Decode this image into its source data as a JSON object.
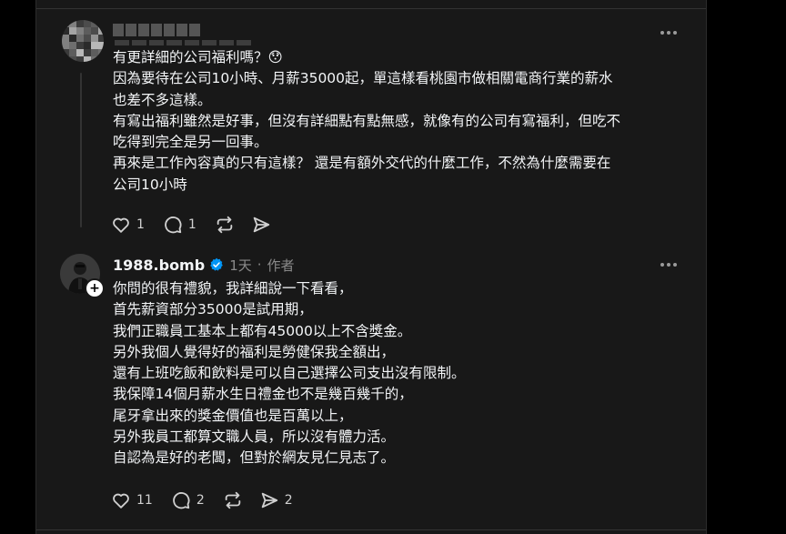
{
  "colors": {
    "background": "#000000",
    "panel": "#181818",
    "text": "#f3f5f7",
    "muted": "#8a8a8a",
    "verified": "#0095f6"
  },
  "comment1": {
    "username": "",
    "lines": [
      "有更詳細的公司福利嗎？😯",
      "因為要待在公司10小時、月薪35000起，單這樣看桃園市做相關電商行業的薪水",
      "也差不多這樣。",
      "有寫出福利雖然是好事，但沒有詳細點有點無感，就像有的公司有寫福利，但吃不",
      "吃得到完全是另一回事。",
      "再來是工作內容真的只有這樣？ 還是有額外交代的什麼工作，不然為什麼需要在",
      "公司10小時"
    ],
    "like_count": "1",
    "reply_count": "1",
    "icons": [
      "heart-icon",
      "comment-icon",
      "repost-icon",
      "share-icon",
      "more-icon"
    ]
  },
  "comment2": {
    "username": "1988.bomb",
    "time": "1天",
    "separator": "·",
    "author_label": "作者",
    "lines": [
      "你問的很有禮貌，我詳細說一下看看，",
      "首先薪資部分35000是試用期，",
      "我們正職員工基本上都有45000以上不含獎金。",
      "另外我個人覺得好的福利是勞健保我全額出，",
      "還有上班吃飯和飲料是可以自己選擇公司支出沒有限制。",
      "我保障14個月薪水生日禮金也不是幾百幾千的，",
      "尾牙拿出來的獎金價值也是百萬以上，",
      "另外我員工都算文職人員，所以沒有體力活。",
      "自認為是好的老闆，但對於網友見仁見志了。"
    ],
    "like_count": "11",
    "reply_count": "2",
    "share_count": "2",
    "plus_label": "+"
  }
}
